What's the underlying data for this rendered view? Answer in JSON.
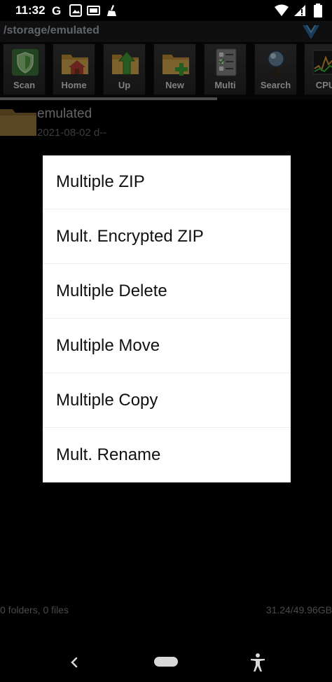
{
  "status_bar": {
    "time": "11:32",
    "left_icons": [
      "google-icon",
      "photo-icon",
      "battery-saver-icon",
      "cleaner-icon"
    ],
    "right_icons": [
      "wifi-icon",
      "no-sim-icon",
      "battery-icon"
    ]
  },
  "path_bar": {
    "path": "/storage/emulated"
  },
  "toolbar": {
    "items": [
      {
        "label": "Scan",
        "icon": "shield-icon"
      },
      {
        "label": "Home",
        "icon": "home-folder-icon"
      },
      {
        "label": "Up",
        "icon": "up-folder-icon"
      },
      {
        "label": "New",
        "icon": "new-folder-icon"
      },
      {
        "label": "Multi",
        "icon": "checklist-icon"
      },
      {
        "label": "Search",
        "icon": "magnifier-icon"
      },
      {
        "label": "CPU",
        "icon": "cpu-graph-icon"
      }
    ]
  },
  "file_list": {
    "items": [
      {
        "name": "emulated",
        "meta": "2021-08-02 d--"
      }
    ]
  },
  "dialog": {
    "items": [
      {
        "label": "Multiple ZIP"
      },
      {
        "label": "Mult. Encrypted ZIP"
      },
      {
        "label": "Multiple Delete"
      },
      {
        "label": "Multiple Move"
      },
      {
        "label": "Multiple Copy"
      },
      {
        "label": "Mult. Rename"
      }
    ]
  },
  "footer": {
    "summary": "0 folders, 0 files",
    "storage": "31.24/49.96GB"
  },
  "colors": {
    "path_text": "#aeb7c0",
    "dialog_bg": "#ffffff",
    "toolbar_bg": "#2e2e2e"
  }
}
